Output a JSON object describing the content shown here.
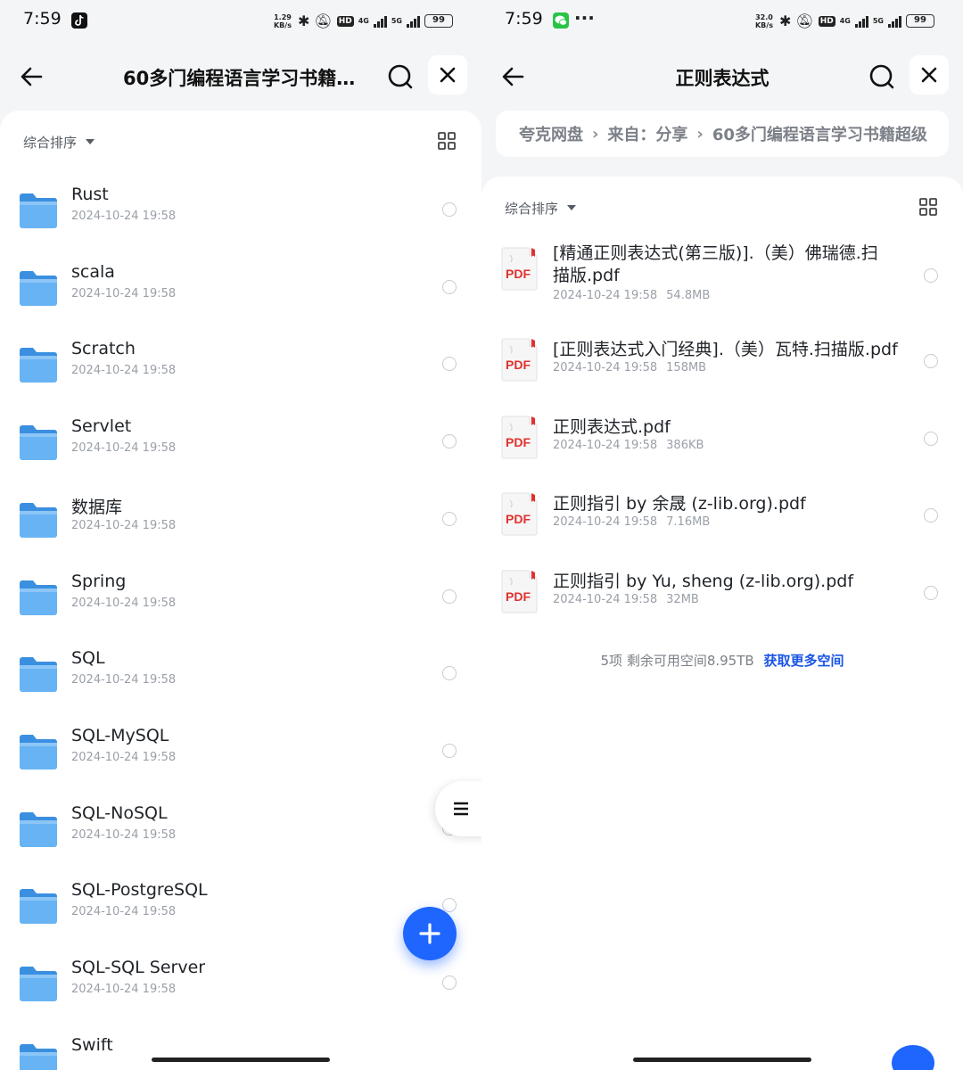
{
  "left": {
    "status": {
      "time": "7:59",
      "speed_top": "1.29",
      "speed_unit": "KB/s",
      "hd": "HD",
      "net_a": "4G",
      "net_b": "5G",
      "battery": "99"
    },
    "title": "60多门编程语言学习书籍...",
    "sort_label": "综合排序",
    "folders": [
      {
        "name": "Rust",
        "date": "2024-10-24 19:58"
      },
      {
        "name": "scala",
        "date": "2024-10-24 19:58"
      },
      {
        "name": "Scratch",
        "date": "2024-10-24 19:58"
      },
      {
        "name": "Servlet",
        "date": "2024-10-24 19:58"
      },
      {
        "name": "数据库",
        "date": "2024-10-24 19:58"
      },
      {
        "name": "Spring",
        "date": "2024-10-24 19:58"
      },
      {
        "name": "SQL",
        "date": "2024-10-24 19:58"
      },
      {
        "name": "SQL-MySQL",
        "date": "2024-10-24 19:58"
      },
      {
        "name": "SQL-NoSQL",
        "date": "2024-10-24 19:58"
      },
      {
        "name": "SQL-PostgreSQL",
        "date": "2024-10-24 19:58"
      },
      {
        "name": "SQL-SQL Server",
        "date": "2024-10-24 19:58"
      },
      {
        "name": "Swift",
        "date": ""
      }
    ]
  },
  "right": {
    "status": {
      "time": "7:59",
      "dots": "···",
      "speed_top": "32.0",
      "speed_unit": "KB/s",
      "hd": "HD",
      "net_a": "4G",
      "net_b": "5G",
      "battery": "99"
    },
    "title": "正则表达式",
    "breadcrumb": [
      "夸克网盘",
      "来自：分享",
      "60多门编程语言学习书籍超级"
    ],
    "sort_label": "综合排序",
    "files": [
      {
        "name": "[精通正则表达式(第三版)].（美）佛瑞德.扫描版.pdf",
        "date": "2024-10-24 19:58",
        "size": "54.8MB"
      },
      {
        "name": "[正则表达式入门经典].（美）瓦特.扫描版.pdf",
        "date": "2024-10-24 19:58",
        "size": "158MB"
      },
      {
        "name": "正则表达式.pdf",
        "date": "2024-10-24 19:58",
        "size": "386KB"
      },
      {
        "name": "正则指引 by 余晟 (z-lib.org).pdf",
        "date": "2024-10-24 19:58",
        "size": "7.16MB"
      },
      {
        "name": "正则指引 by Yu, sheng (z-lib.org).pdf",
        "date": "2024-10-24 19:58",
        "size": "32MB"
      }
    ],
    "footer": {
      "count": "5项",
      "space": "剩余可用空间8.95TB",
      "link": "获取更多空间"
    }
  },
  "pdf_badge": "PDF",
  "colors": {
    "accent": "#1f66ff",
    "folder": "#5aaaf0",
    "pdf": "#e0312d",
    "link": "#1a56e6"
  }
}
